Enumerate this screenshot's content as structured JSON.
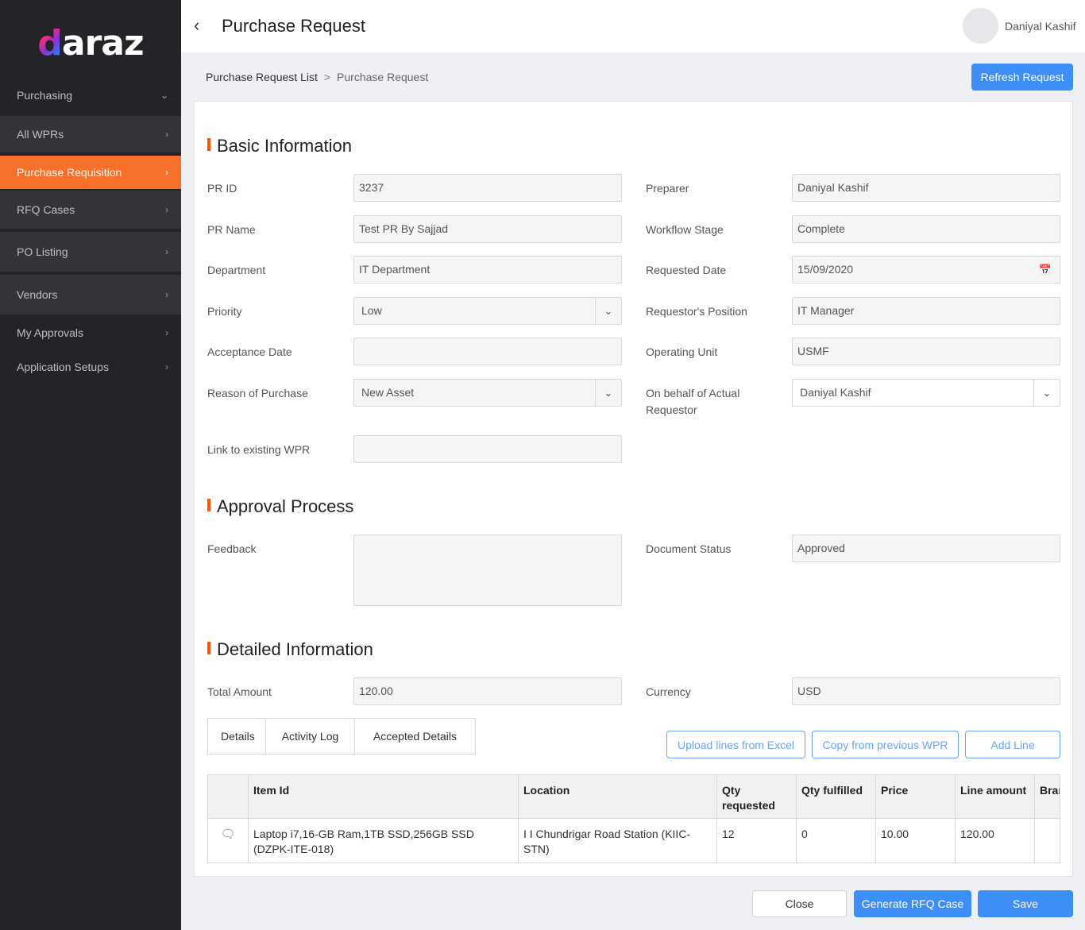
{
  "brand": {
    "logo_text": "daraz",
    "logo_colors": [
      "#f85606",
      "#ff2d6f",
      "#8c2fd6",
      "#2a7cf7",
      "#ffb300"
    ]
  },
  "sidebar": {
    "items": [
      {
        "label": "Purchasing",
        "icon": "chevron-down-icon"
      },
      {
        "label": "All WPRs",
        "icon": "chevron-right-icon"
      },
      {
        "label": "Purchase Requisition",
        "icon": "chevron-right-icon",
        "active": true
      },
      {
        "label": "RFQ Cases",
        "icon": "chevron-right-icon"
      },
      {
        "label": "PO Listing",
        "icon": "chevron-right-icon"
      },
      {
        "label": "Vendors",
        "icon": "chevron-right-icon"
      },
      {
        "label": "My Approvals",
        "icon": "chevron-right-icon"
      },
      {
        "label": "Application Setups",
        "icon": "chevron-right-icon"
      }
    ]
  },
  "header": {
    "title": "Purchase Request",
    "user_name": "Daniyal Kashif"
  },
  "breadcrumb": {
    "parent": "Purchase Request List",
    "separator": ">",
    "current": "Purchase Request"
  },
  "actions": {
    "refresh": "Refresh Request"
  },
  "sections": {
    "basic": "Basic Information",
    "approval": "Approval Process",
    "detailed": "Detailed Information"
  },
  "basic": {
    "pr_id": {
      "label": "PR ID",
      "value": "3237"
    },
    "pr_name": {
      "label": "PR Name",
      "value": "Test PR By Sajjad"
    },
    "department": {
      "label": "Department",
      "value": "IT Department"
    },
    "priority": {
      "label": "Priority",
      "value": "Low"
    },
    "acceptance_date": {
      "label": "Acceptance Date",
      "value": ""
    },
    "reason": {
      "label": "Reason of Purchase",
      "value": "New Asset"
    },
    "link_wpr": {
      "label": "Link to existing WPR",
      "value": ""
    },
    "preparer": {
      "label": "Preparer",
      "value": "Daniyal Kashif"
    },
    "workflow_stage": {
      "label": "Workflow Stage",
      "value": "Complete"
    },
    "requested_date": {
      "label": "Requested Date",
      "value": "15/09/2020"
    },
    "requestor_position": {
      "label": "Requestor's Position",
      "value": "IT Manager"
    },
    "operating_unit": {
      "label": "Operating Unit",
      "value": "USMF"
    },
    "on_behalf": {
      "label_line1": "On behalf of Actual",
      "label_line2": "Requestor",
      "value": "Daniyal Kashif"
    }
  },
  "approval": {
    "feedback": {
      "label": "Feedback",
      "value": ""
    },
    "document_status": {
      "label": "Document Status",
      "value": "Approved"
    }
  },
  "detailed": {
    "total_amount": {
      "label": "Total Amount",
      "value": "120.00"
    },
    "currency": {
      "label": "Currency",
      "value": "USD"
    }
  },
  "tabs": [
    "Details",
    "Activity Log",
    "Accepted Details"
  ],
  "line_actions": {
    "upload": "Upload lines from Excel",
    "copy": "Copy from previous WPR",
    "add": "Add Line"
  },
  "table": {
    "headers": [
      "",
      "Item Id",
      "Location",
      "Qty requested",
      "Qty fulfilled",
      "Price",
      "Line amount",
      "Brand"
    ],
    "rows": [
      {
        "icon": "comments-icon",
        "item_id": "Laptop i7,16-GB Ram,1TB SSD,256GB SSD (DZPK-ITE-018)",
        "location": "I I Chundrigar Road Station (KIIC-STN)",
        "qty_requested": "12",
        "qty_fulfilled": "0",
        "price": "10.00",
        "line_amount": "120.00",
        "brand": ""
      }
    ]
  },
  "footer": {
    "close": "Close",
    "generate_rfq": "Generate RFQ Case",
    "save": "Save"
  }
}
